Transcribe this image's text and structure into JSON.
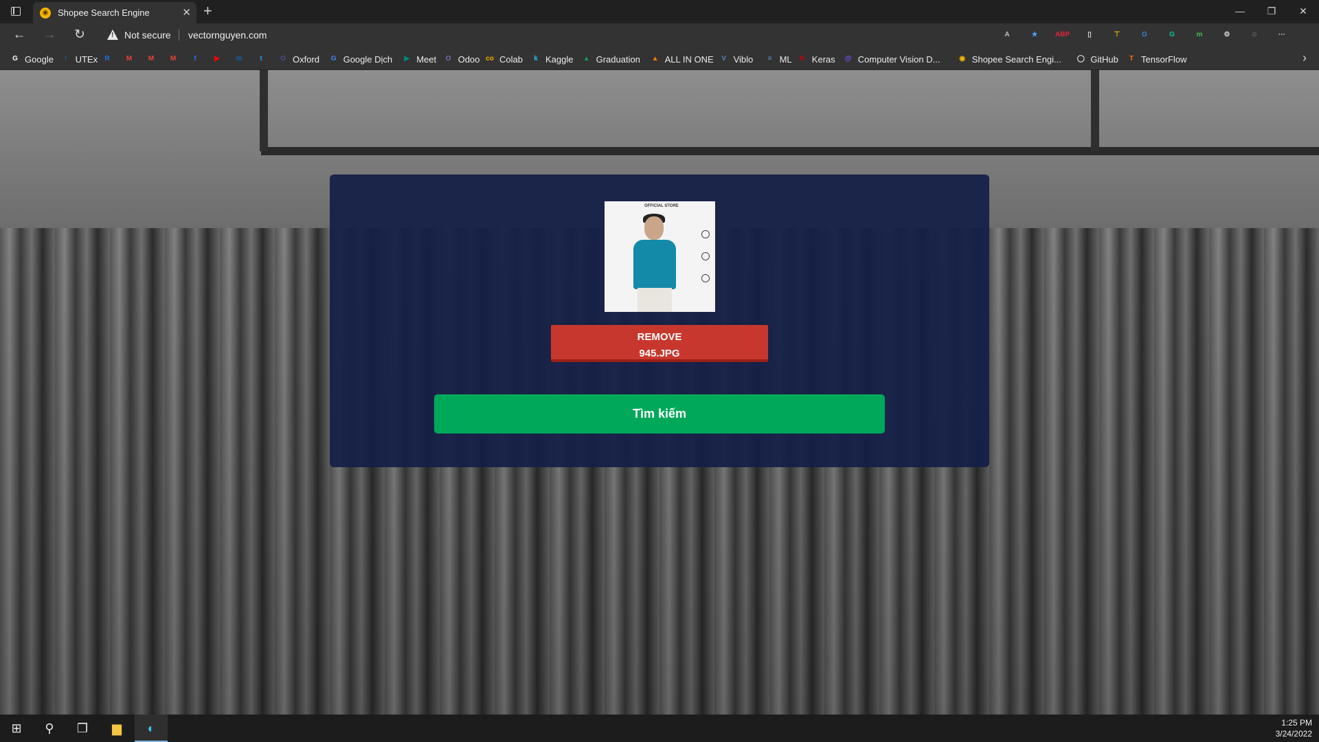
{
  "tab": {
    "title": "Shopee Search Engine",
    "close": "✕",
    "new_tab": "+"
  },
  "window_controls": {
    "minimize": "—",
    "restore": "❐",
    "close": "✕"
  },
  "nav": {
    "back": "←",
    "forward": "→",
    "reload": "↻"
  },
  "address": {
    "security_text": "Not secure",
    "url": "vectornguyen.com"
  },
  "extensions": [
    {
      "name": "read-aloud-icon",
      "label": "A",
      "color": "#bdbdbd"
    },
    {
      "name": "favorite-star-icon",
      "label": "★",
      "color": "#4aa3ff"
    },
    {
      "name": "adblock-icon",
      "label": "ABP",
      "color": "#e0243a"
    },
    {
      "name": "phone-icon",
      "label": "▯",
      "color": "#e0e0e0"
    },
    {
      "name": "pick-icon",
      "label": "⊤",
      "color": "#f5b400"
    },
    {
      "name": "translate-icon",
      "label": "G",
      "color": "#3b7ddd"
    },
    {
      "name": "grammarly-icon",
      "label": "G",
      "color": "#15c39a"
    },
    {
      "name": "kami-icon",
      "label": "m",
      "color": "#3cc04a"
    },
    {
      "name": "extensions-icon",
      "label": "⚙",
      "color": "#d6d6d6"
    },
    {
      "name": "profile-avatar-icon",
      "label": "☺",
      "color": "#8a8a8a"
    },
    {
      "name": "more-menu-icon",
      "label": "···",
      "color": "#d6d6d6"
    }
  ],
  "bookmarks": [
    {
      "label": "Google",
      "icon": "G",
      "color": "#ffffff"
    },
    {
      "label": "UTEx",
      "icon": "↑",
      "color": "#1a73e8"
    },
    {
      "label": "",
      "icon": "R",
      "color": "#1a73e8"
    },
    {
      "label": "",
      "icon": "M",
      "color": "#ea4335"
    },
    {
      "label": "",
      "icon": "M",
      "color": "#ea4335"
    },
    {
      "label": "",
      "icon": "M",
      "color": "#ea4335"
    },
    {
      "label": "",
      "icon": "f",
      "color": "#1877f2"
    },
    {
      "label": "",
      "icon": "▶",
      "color": "#ff0000"
    },
    {
      "label": "",
      "icon": "in",
      "color": "#0a66c2"
    },
    {
      "label": "",
      "icon": "t",
      "color": "#1d9bf0"
    },
    {
      "label": "Oxford",
      "icon": "O",
      "color": "#4a4a9a"
    },
    {
      "label": "Google Dịch",
      "icon": "G",
      "color": "#4285f4"
    },
    {
      "label": "Meet",
      "icon": "▶",
      "color": "#00897b"
    },
    {
      "label": "Odoo",
      "icon": "O",
      "color": "#7c6cbb"
    },
    {
      "label": "Colab",
      "icon": "co",
      "color": "#f9ab00"
    },
    {
      "label": "Kaggle",
      "icon": "k",
      "color": "#20beff"
    },
    {
      "label": "Graduation",
      "icon": "▲",
      "color": "#0f9d58"
    },
    {
      "label": "ALL IN ONE",
      "icon": "▲",
      "color": "#f57c00"
    },
    {
      "label": "Viblo",
      "icon": "V",
      "color": "#5387c6"
    },
    {
      "label": "ML",
      "icon": "≡",
      "color": "#4a90d9"
    },
    {
      "label": "Keras",
      "icon": "K",
      "color": "#d00000"
    },
    {
      "label": "Computer Vision D...",
      "icon": "@",
      "color": "#7c4dff"
    },
    {
      "label": "Shopee Search Engi...",
      "icon": "◉",
      "color": "#f5b400"
    },
    {
      "label": "GitHub",
      "icon": "◯",
      "color": "#e8e8e8"
    },
    {
      "label": "TensorFlow",
      "icon": "T",
      "color": "#ff6f00"
    }
  ],
  "bookmarks_more": "›",
  "main": {
    "preview_brand": "OFFICIAL STORE",
    "remove_line1": "REMOVE",
    "remove_line2": "945.JPG",
    "search_label": "Tìm kiếm"
  },
  "taskbar": {
    "start": "⊞",
    "search": "⚲",
    "task_view": "❐",
    "explorer": "▆",
    "edge": "◐",
    "time": "1:25 PM",
    "date": "3/24/2022"
  }
}
